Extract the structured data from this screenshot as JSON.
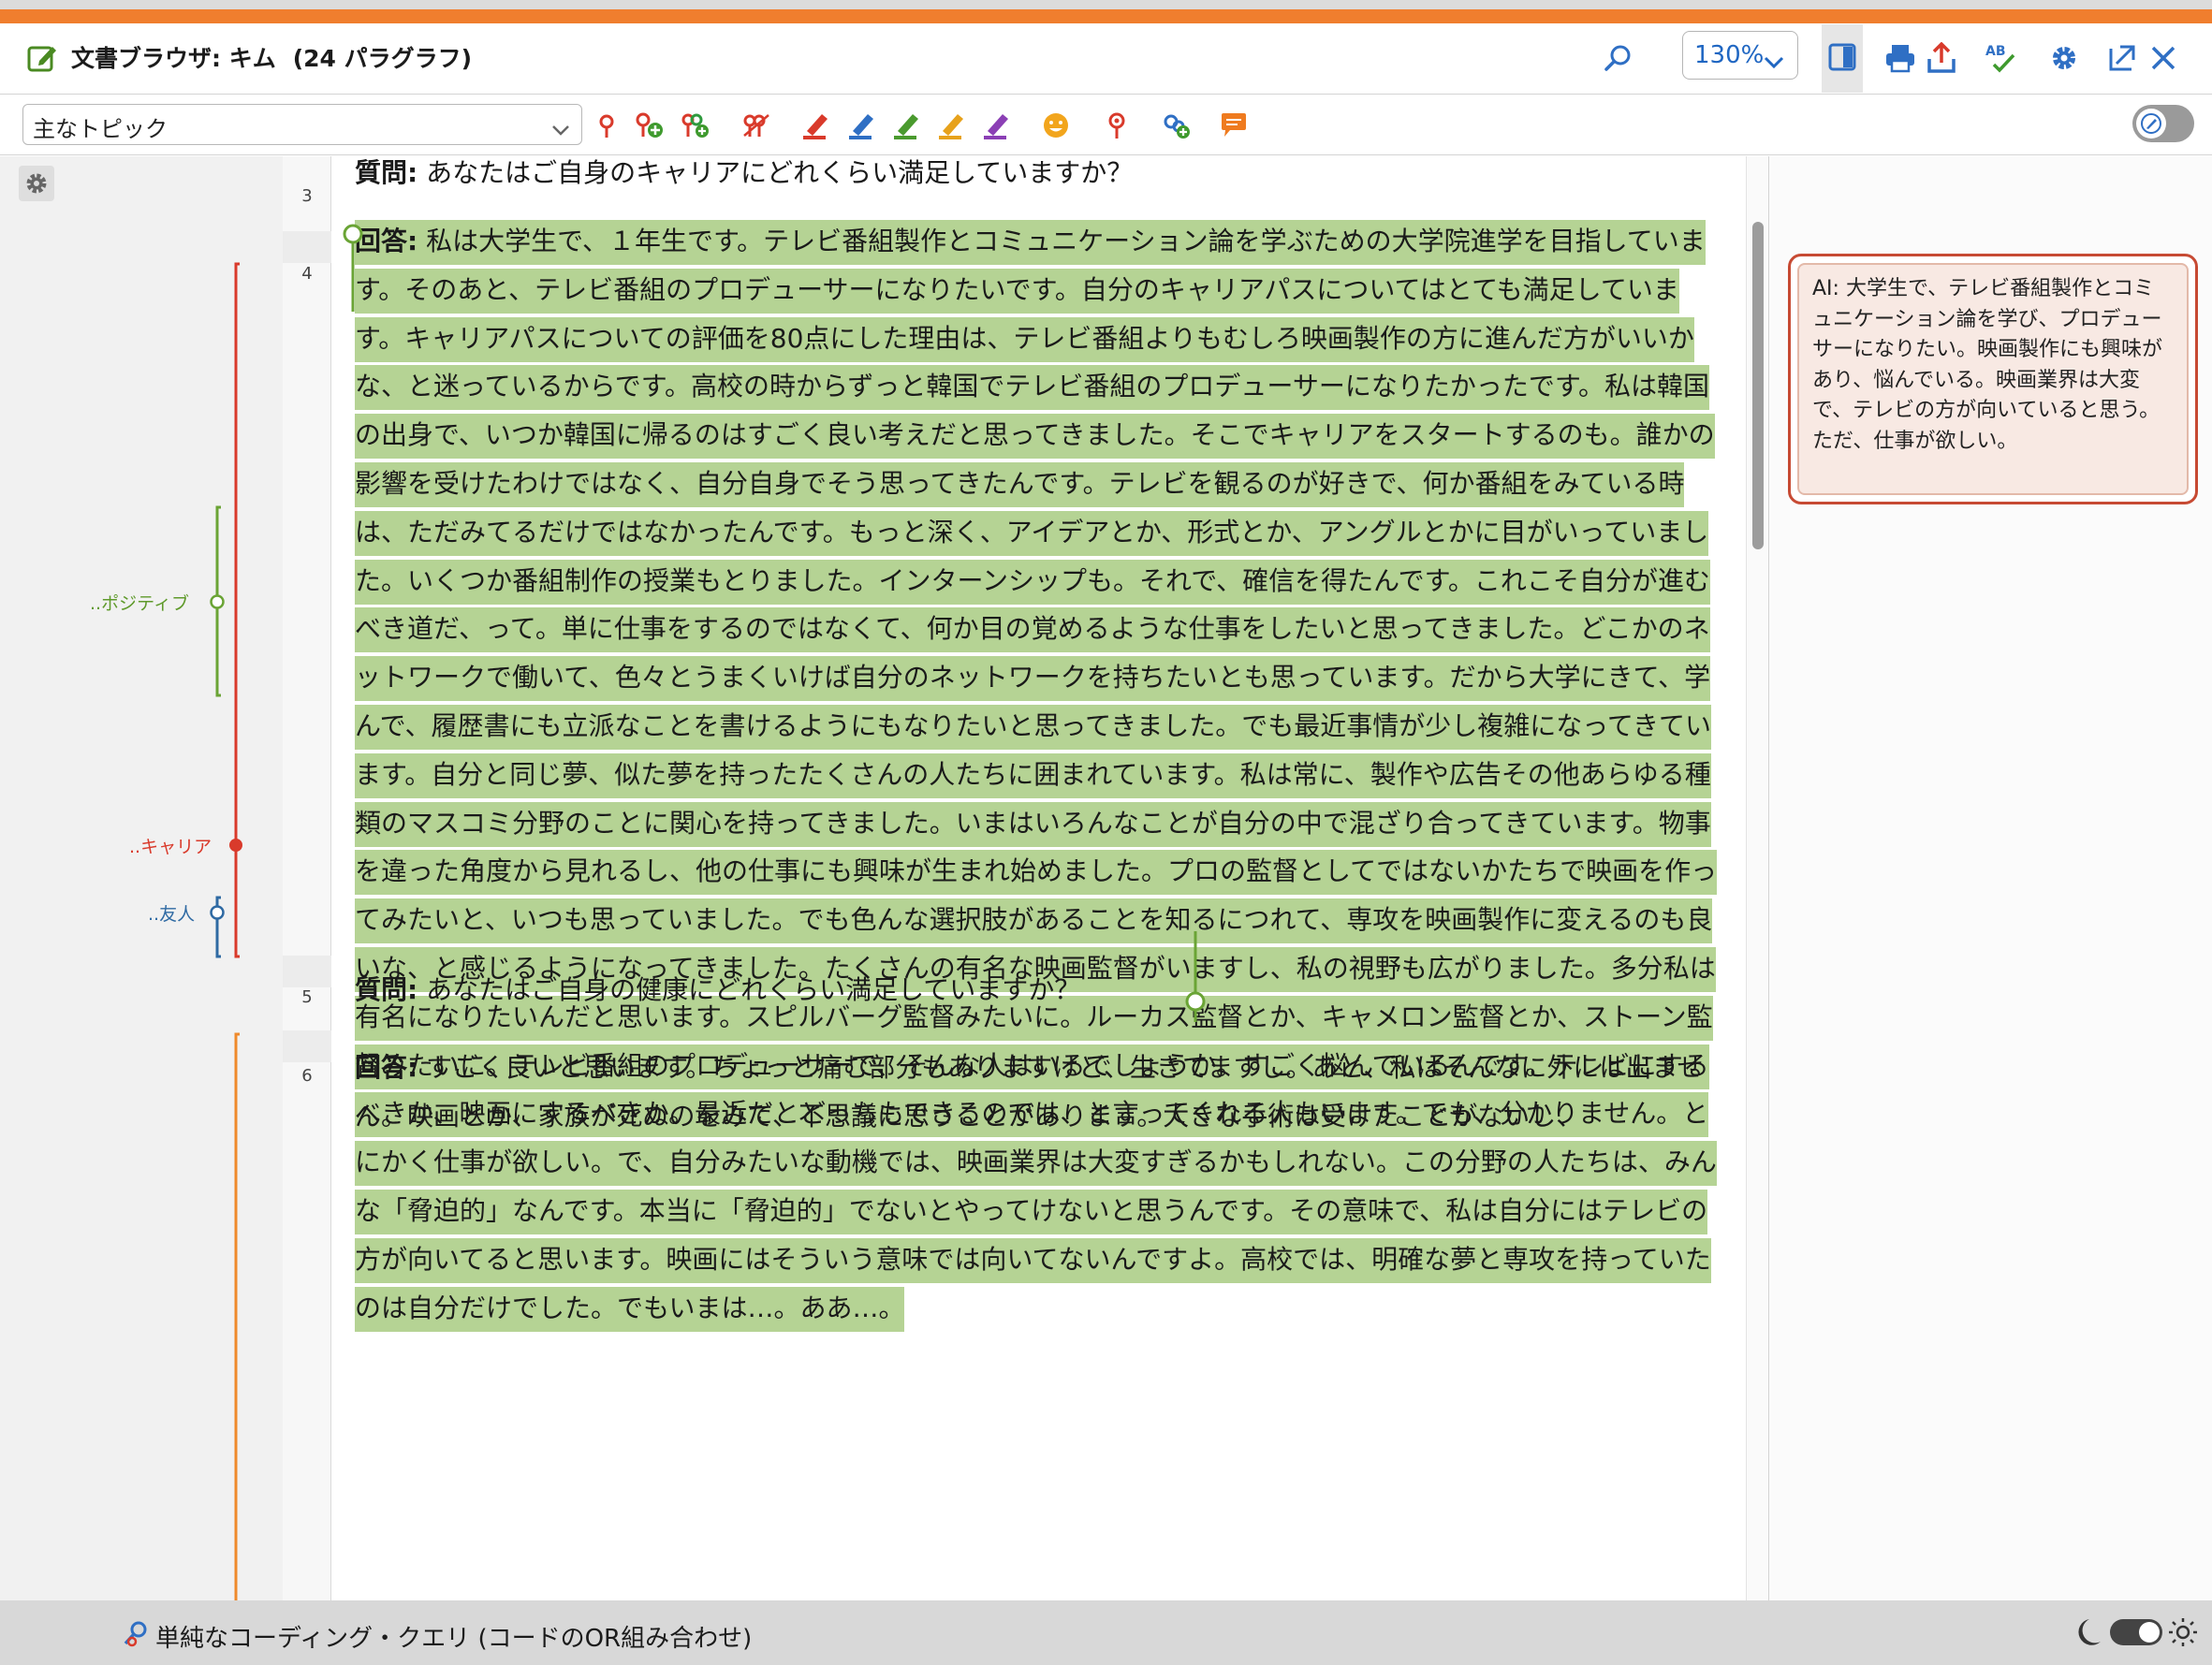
{
  "window": {
    "title": "文書ブラウザ: キム",
    "paragraph_count": "(24 パラグラフ)",
    "zoom": "130%"
  },
  "toolbar": {
    "topic_select": "主なトピック"
  },
  "colors": {
    "accent": "#f07e2e",
    "highlight": "#b5d394",
    "code_career": "#d93a2b",
    "code_positive": "#6aa435",
    "code_friend": "#2f6aa3",
    "code_health": "#ef8a2c",
    "memo_border": "#c74a33"
  },
  "codes": [
    {
      "label": "..ポジティブ"
    },
    {
      "label": "..キャリア"
    },
    {
      "label": "..友人"
    }
  ],
  "paragraphs": [
    {
      "num": "3",
      "prefix": "質問:",
      "text": " あなたはご自身のキャリアにどれくらい満足していますか？"
    },
    {
      "num": "4",
      "prefix": "回答:",
      "text": " 私は大学生で、１年生です。テレビ番組製作とコミュニケーション論を学ぶための大学院進学を目指しています。そのあと、テレビ番組のプロデューサーになりたいです。自分のキャリアパスについてはとても満足しています。キャリアパスについての評価を80点にした理由は、テレビ番組よりもむしろ映画製作の方に進んだ方がいいかな、と迷っているからです。高校の時からずっと韓国でテレビ番組のプロデューサーになりたかったです。私は韓国の出身で、いつか韓国に帰るのはすごく良い考えだと思ってきました。そこでキャリアをスタートするのも。誰かの影響を受けたわけではなく、自分自身でそう思ってきたんです。テレビを観るのが好きで、何か番組をみている時は、ただみてるだけではなかったんです。もっと深く、アイデアとか、形式とか、アングルとかに目がいっていました。いくつか番組制作の授業もとりました。インターンシップも。それで、確信を得たんです。これこそ自分が進むべき道だ、って。単に仕事をするのではなくて、何か目の覚めるような仕事をしたいと思ってきました。どこかのネットワークで働いて、色々とうまくいけば自分のネットワークを持ちたいとも思っています。だから大学にきて、学んで、履歴書にも立派なことを書けるようにもなりたいと思ってきました。でも最近事情が少し複雑になってきています。自分と同じ夢、似た夢を持ったたくさんの人たちに囲まれています。私は常に、製作や広告その他あらゆる種類のマスコミ分野のことに関心を持ってきました。いまはいろんなことが自分の中で混ざり合ってきています。物事を違った角度から見れるし、他の仕事にも興味が生まれ始めました。プロの監督としてではないかたちで映画を作ってみたいと、いつも思っていました。でも色んな選択肢があることを知るにつれて、専攻を映画製作に変えるのも良いな、と感じるようになってきました。たくさんの有名な映画監督がいますし、私の視野も広がりました。多分私は有名になりたいんだと思います。スピルバーグ監督みたいに。ルーカス監督とか、キャメロン監督とか、ストーン監督みたいに。テレビ番組のプロデューサーで、そんな人はいるでしょうか。すごく悩んでいるんです。テレビにするべきか、映画にするべきか。最近だとどっちもできるのでは、と言ってくれる人もいます。でも、分かりません。とにかく仕事が欲しい。で、自分みたいな動機では、映画業界は大変すぎるかもしれない。この分野の人たちは、みんな「脅迫的」なんです。本当に「脅迫的」でないとやってけないと思うんです。その意味で、私は自分にはテレビの方が向いてると思います。映画にはそういう意味では向いてないんですよ。高校では、明確な夢と専攻を持っていたのは自分だけでした。でもいまは…。ああ…。"
    },
    {
      "num": "5",
      "prefix": "質問:",
      "text": " あなたはご自身の健康にどれくらい満足していますか？"
    },
    {
      "num": "6",
      "prefix": "回答:",
      "text": " すごく良いと思います。ちょっと痛む部分もありますけど、生きてますし。あと、私はそんなに外には出ません。映画とか、家族が死ぬのをみて、不思議に思うことがあります。大きな手術は受けたことがないし、"
    }
  ],
  "memo": {
    "text": "AI: 大学生で、テレビ番組製作とコミュニケーション論を学び、プロデューサーになりたい。映画製作にも興味があり、悩んでいる。映画業界は大変で、テレビの方が向いていると思う。ただ、仕事が欲しい。"
  },
  "status": {
    "query_label": "単純なコーディング・クエリ (コードのOR組み合わせ)"
  }
}
